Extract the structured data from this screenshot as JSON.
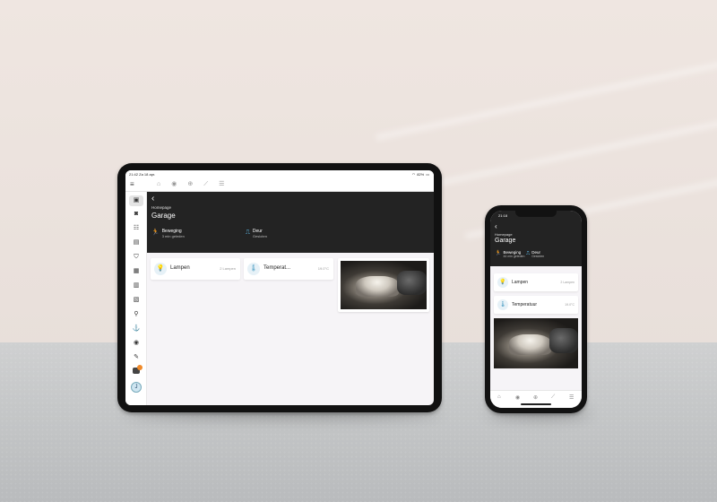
{
  "tablet": {
    "status_time": "21:42",
    "status_date": "Za 18 apr.",
    "status_battery": "82%",
    "menu_icon": "≡",
    "nav_icons": [
      "⌂",
      "◉",
      "⊕",
      "⟋",
      "☰"
    ],
    "sidebar_icons": [
      "▣",
      "◙",
      "☷",
      "▤",
      "⛉",
      "▦",
      "▥",
      "▧",
      "⚲",
      "⚓",
      "◉",
      "✎"
    ],
    "avatar_letter": "J"
  },
  "header": {
    "back": "‹",
    "breadcrumb": "Homepage",
    "title": "Garage",
    "sensors": [
      {
        "icon": "🏃",
        "label": "Beweging",
        "sub": "3 min geleden"
      },
      {
        "icon": "⎍",
        "label": "Deur",
        "sub": "Gesloten"
      }
    ]
  },
  "phone_header": {
    "time": "21:18",
    "sensors": [
      {
        "icon": "🏃",
        "label": "Beweging",
        "sub": "44 min geleden"
      },
      {
        "icon": "⎍",
        "label": "Deur",
        "sub": "Gesloten"
      }
    ]
  },
  "tablet_cards": [
    {
      "icon": "💡",
      "name": "Lampen",
      "value": "2 Lampen"
    },
    {
      "icon": "🌡",
      "name": "Temperat...",
      "value": "19.0°C"
    }
  ],
  "phone_cards": [
    {
      "icon": "💡",
      "name": "Lampen",
      "value": "2 Lampen"
    },
    {
      "icon": "🌡",
      "name": "Temperatuur",
      "value": "19.0°C"
    }
  ],
  "phone_tabs": [
    "⌂",
    "◉",
    "⊕",
    "⟋",
    "☰"
  ]
}
